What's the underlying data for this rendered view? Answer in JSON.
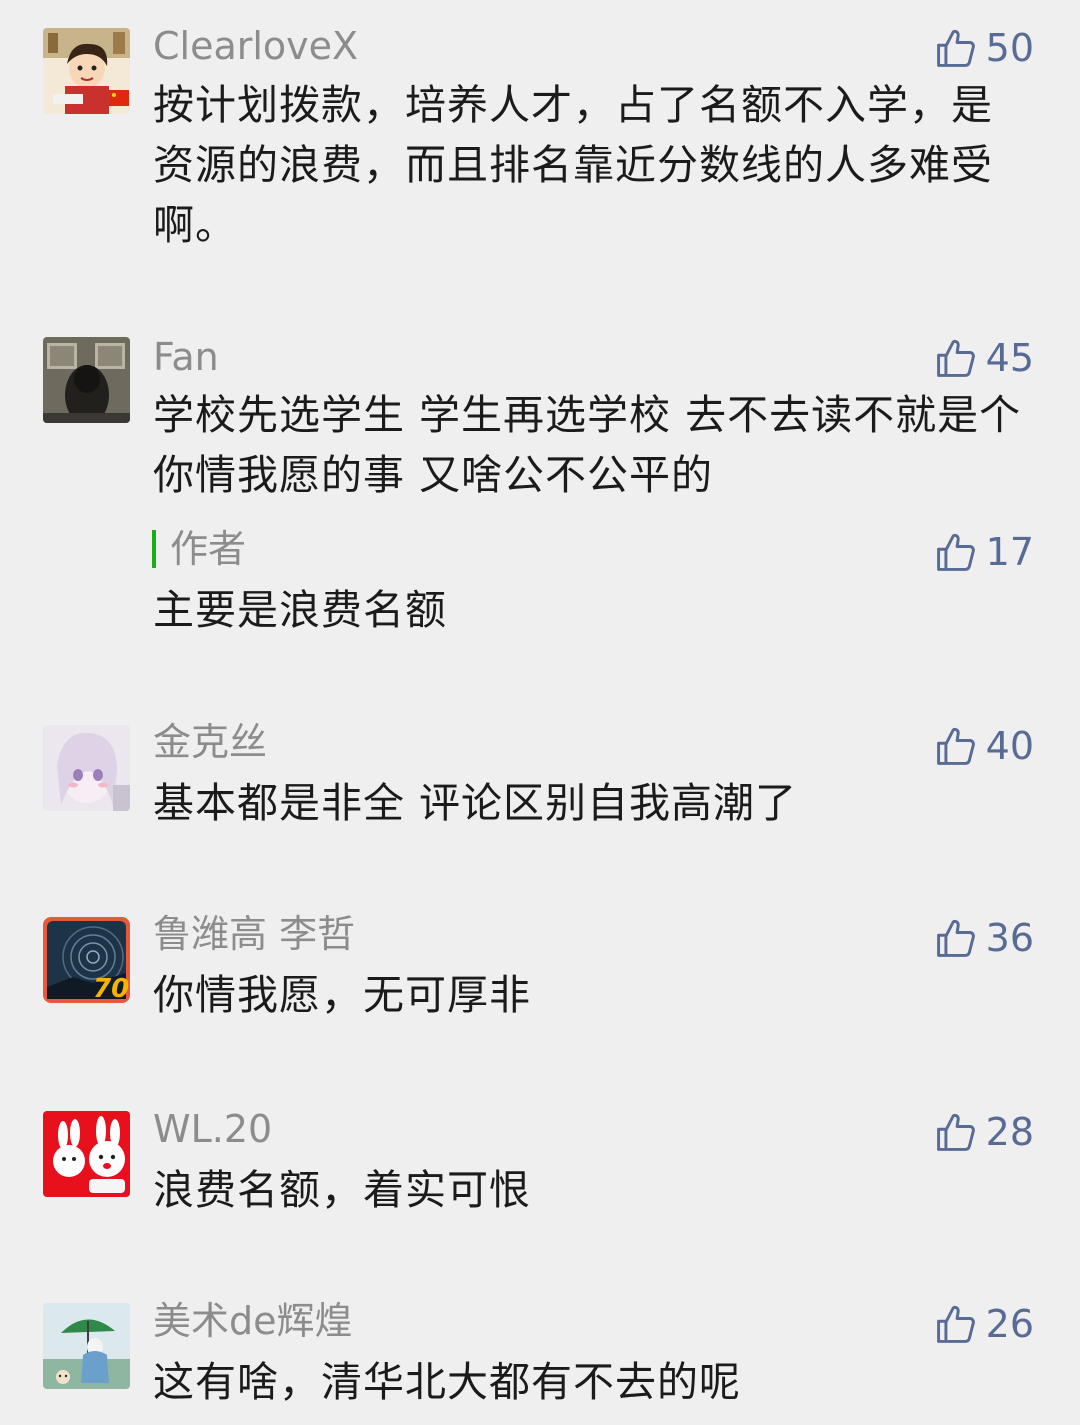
{
  "comments": [
    {
      "username": "ClearloveX",
      "likes": "50",
      "content": "按计划拨款，培养人才，占了名额不入学，是资源的浪费，而且排名靠近分数线的人多难受啊。"
    },
    {
      "username": "Fan",
      "likes": "45",
      "content": "学校先选学生 学生再选学校 去不去读不就是个你情我愿的事 又啥公不公平的",
      "reply": {
        "author": "作者",
        "likes": "17",
        "content": "主要是浪费名额"
      }
    },
    {
      "username": "金克丝",
      "likes": "40",
      "content": "基本都是非全 评论区别自我高潮了"
    },
    {
      "username": "鲁潍高 李哲",
      "likes": "36",
      "content": "你情我愿，无可厚非",
      "avatar_badge": "70"
    },
    {
      "username": "WL.20",
      "likes": "28",
      "content": "浪费名额，着实可恨"
    },
    {
      "username": "美术de辉煌",
      "likes": "26",
      "content": "这有啥，清华北大都有不去的呢"
    }
  ],
  "icons": {
    "like": "thumbs-up-outline-icon"
  },
  "colors": {
    "background": "#efefef",
    "username": "#8c8c8c",
    "like": "#576b95",
    "text": "#1b1b1b",
    "author_bar": "#1aad19"
  }
}
